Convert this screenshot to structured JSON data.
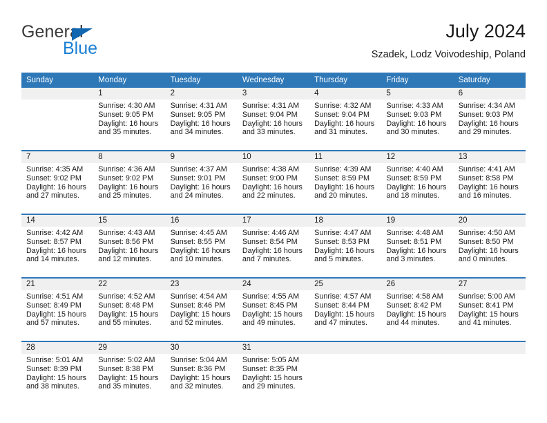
{
  "brand": {
    "name_part1": "General",
    "name_part2": "Blue",
    "accent_color": "#1a7fd4",
    "triangle_color": "#1266b0"
  },
  "header": {
    "title": "July 2024",
    "subtitle": "Szadek, Lodz Voivodeship, Poland"
  },
  "calendar": {
    "header_bg": "#2e78b8",
    "header_text_color": "#ffffff",
    "daynum_band_bg": "#f0f0f0",
    "weekday_headers": [
      "Sunday",
      "Monday",
      "Tuesday",
      "Wednesday",
      "Thursday",
      "Friday",
      "Saturday"
    ],
    "weeks": [
      [
        {
          "day": "",
          "lines": []
        },
        {
          "day": "1",
          "lines": [
            "Sunrise: 4:30 AM",
            "Sunset: 9:05 PM",
            "Daylight: 16 hours",
            "and 35 minutes."
          ]
        },
        {
          "day": "2",
          "lines": [
            "Sunrise: 4:31 AM",
            "Sunset: 9:05 PM",
            "Daylight: 16 hours",
            "and 34 minutes."
          ]
        },
        {
          "day": "3",
          "lines": [
            "Sunrise: 4:31 AM",
            "Sunset: 9:04 PM",
            "Daylight: 16 hours",
            "and 33 minutes."
          ]
        },
        {
          "day": "4",
          "lines": [
            "Sunrise: 4:32 AM",
            "Sunset: 9:04 PM",
            "Daylight: 16 hours",
            "and 31 minutes."
          ]
        },
        {
          "day": "5",
          "lines": [
            "Sunrise: 4:33 AM",
            "Sunset: 9:03 PM",
            "Daylight: 16 hours",
            "and 30 minutes."
          ]
        },
        {
          "day": "6",
          "lines": [
            "Sunrise: 4:34 AM",
            "Sunset: 9:03 PM",
            "Daylight: 16 hours",
            "and 29 minutes."
          ]
        }
      ],
      [
        {
          "day": "7",
          "lines": [
            "Sunrise: 4:35 AM",
            "Sunset: 9:02 PM",
            "Daylight: 16 hours",
            "and 27 minutes."
          ]
        },
        {
          "day": "8",
          "lines": [
            "Sunrise: 4:36 AM",
            "Sunset: 9:02 PM",
            "Daylight: 16 hours",
            "and 25 minutes."
          ]
        },
        {
          "day": "9",
          "lines": [
            "Sunrise: 4:37 AM",
            "Sunset: 9:01 PM",
            "Daylight: 16 hours",
            "and 24 minutes."
          ]
        },
        {
          "day": "10",
          "lines": [
            "Sunrise: 4:38 AM",
            "Sunset: 9:00 PM",
            "Daylight: 16 hours",
            "and 22 minutes."
          ]
        },
        {
          "day": "11",
          "lines": [
            "Sunrise: 4:39 AM",
            "Sunset: 8:59 PM",
            "Daylight: 16 hours",
            "and 20 minutes."
          ]
        },
        {
          "day": "12",
          "lines": [
            "Sunrise: 4:40 AM",
            "Sunset: 8:59 PM",
            "Daylight: 16 hours",
            "and 18 minutes."
          ]
        },
        {
          "day": "13",
          "lines": [
            "Sunrise: 4:41 AM",
            "Sunset: 8:58 PM",
            "Daylight: 16 hours",
            "and 16 minutes."
          ]
        }
      ],
      [
        {
          "day": "14",
          "lines": [
            "Sunrise: 4:42 AM",
            "Sunset: 8:57 PM",
            "Daylight: 16 hours",
            "and 14 minutes."
          ]
        },
        {
          "day": "15",
          "lines": [
            "Sunrise: 4:43 AM",
            "Sunset: 8:56 PM",
            "Daylight: 16 hours",
            "and 12 minutes."
          ]
        },
        {
          "day": "16",
          "lines": [
            "Sunrise: 4:45 AM",
            "Sunset: 8:55 PM",
            "Daylight: 16 hours",
            "and 10 minutes."
          ]
        },
        {
          "day": "17",
          "lines": [
            "Sunrise: 4:46 AM",
            "Sunset: 8:54 PM",
            "Daylight: 16 hours",
            "and 7 minutes."
          ]
        },
        {
          "day": "18",
          "lines": [
            "Sunrise: 4:47 AM",
            "Sunset: 8:53 PM",
            "Daylight: 16 hours",
            "and 5 minutes."
          ]
        },
        {
          "day": "19",
          "lines": [
            "Sunrise: 4:48 AM",
            "Sunset: 8:51 PM",
            "Daylight: 16 hours",
            "and 3 minutes."
          ]
        },
        {
          "day": "20",
          "lines": [
            "Sunrise: 4:50 AM",
            "Sunset: 8:50 PM",
            "Daylight: 16 hours",
            "and 0 minutes."
          ]
        }
      ],
      [
        {
          "day": "21",
          "lines": [
            "Sunrise: 4:51 AM",
            "Sunset: 8:49 PM",
            "Daylight: 15 hours",
            "and 57 minutes."
          ]
        },
        {
          "day": "22",
          "lines": [
            "Sunrise: 4:52 AM",
            "Sunset: 8:48 PM",
            "Daylight: 15 hours",
            "and 55 minutes."
          ]
        },
        {
          "day": "23",
          "lines": [
            "Sunrise: 4:54 AM",
            "Sunset: 8:46 PM",
            "Daylight: 15 hours",
            "and 52 minutes."
          ]
        },
        {
          "day": "24",
          "lines": [
            "Sunrise: 4:55 AM",
            "Sunset: 8:45 PM",
            "Daylight: 15 hours",
            "and 49 minutes."
          ]
        },
        {
          "day": "25",
          "lines": [
            "Sunrise: 4:57 AM",
            "Sunset: 8:44 PM",
            "Daylight: 15 hours",
            "and 47 minutes."
          ]
        },
        {
          "day": "26",
          "lines": [
            "Sunrise: 4:58 AM",
            "Sunset: 8:42 PM",
            "Daylight: 15 hours",
            "and 44 minutes."
          ]
        },
        {
          "day": "27",
          "lines": [
            "Sunrise: 5:00 AM",
            "Sunset: 8:41 PM",
            "Daylight: 15 hours",
            "and 41 minutes."
          ]
        }
      ],
      [
        {
          "day": "28",
          "lines": [
            "Sunrise: 5:01 AM",
            "Sunset: 8:39 PM",
            "Daylight: 15 hours",
            "and 38 minutes."
          ]
        },
        {
          "day": "29",
          "lines": [
            "Sunrise: 5:02 AM",
            "Sunset: 8:38 PM",
            "Daylight: 15 hours",
            "and 35 minutes."
          ]
        },
        {
          "day": "30",
          "lines": [
            "Sunrise: 5:04 AM",
            "Sunset: 8:36 PM",
            "Daylight: 15 hours",
            "and 32 minutes."
          ]
        },
        {
          "day": "31",
          "lines": [
            "Sunrise: 5:05 AM",
            "Sunset: 8:35 PM",
            "Daylight: 15 hours",
            "and 29 minutes."
          ]
        },
        {
          "day": "",
          "lines": []
        },
        {
          "day": "",
          "lines": []
        },
        {
          "day": "",
          "lines": []
        }
      ]
    ]
  }
}
